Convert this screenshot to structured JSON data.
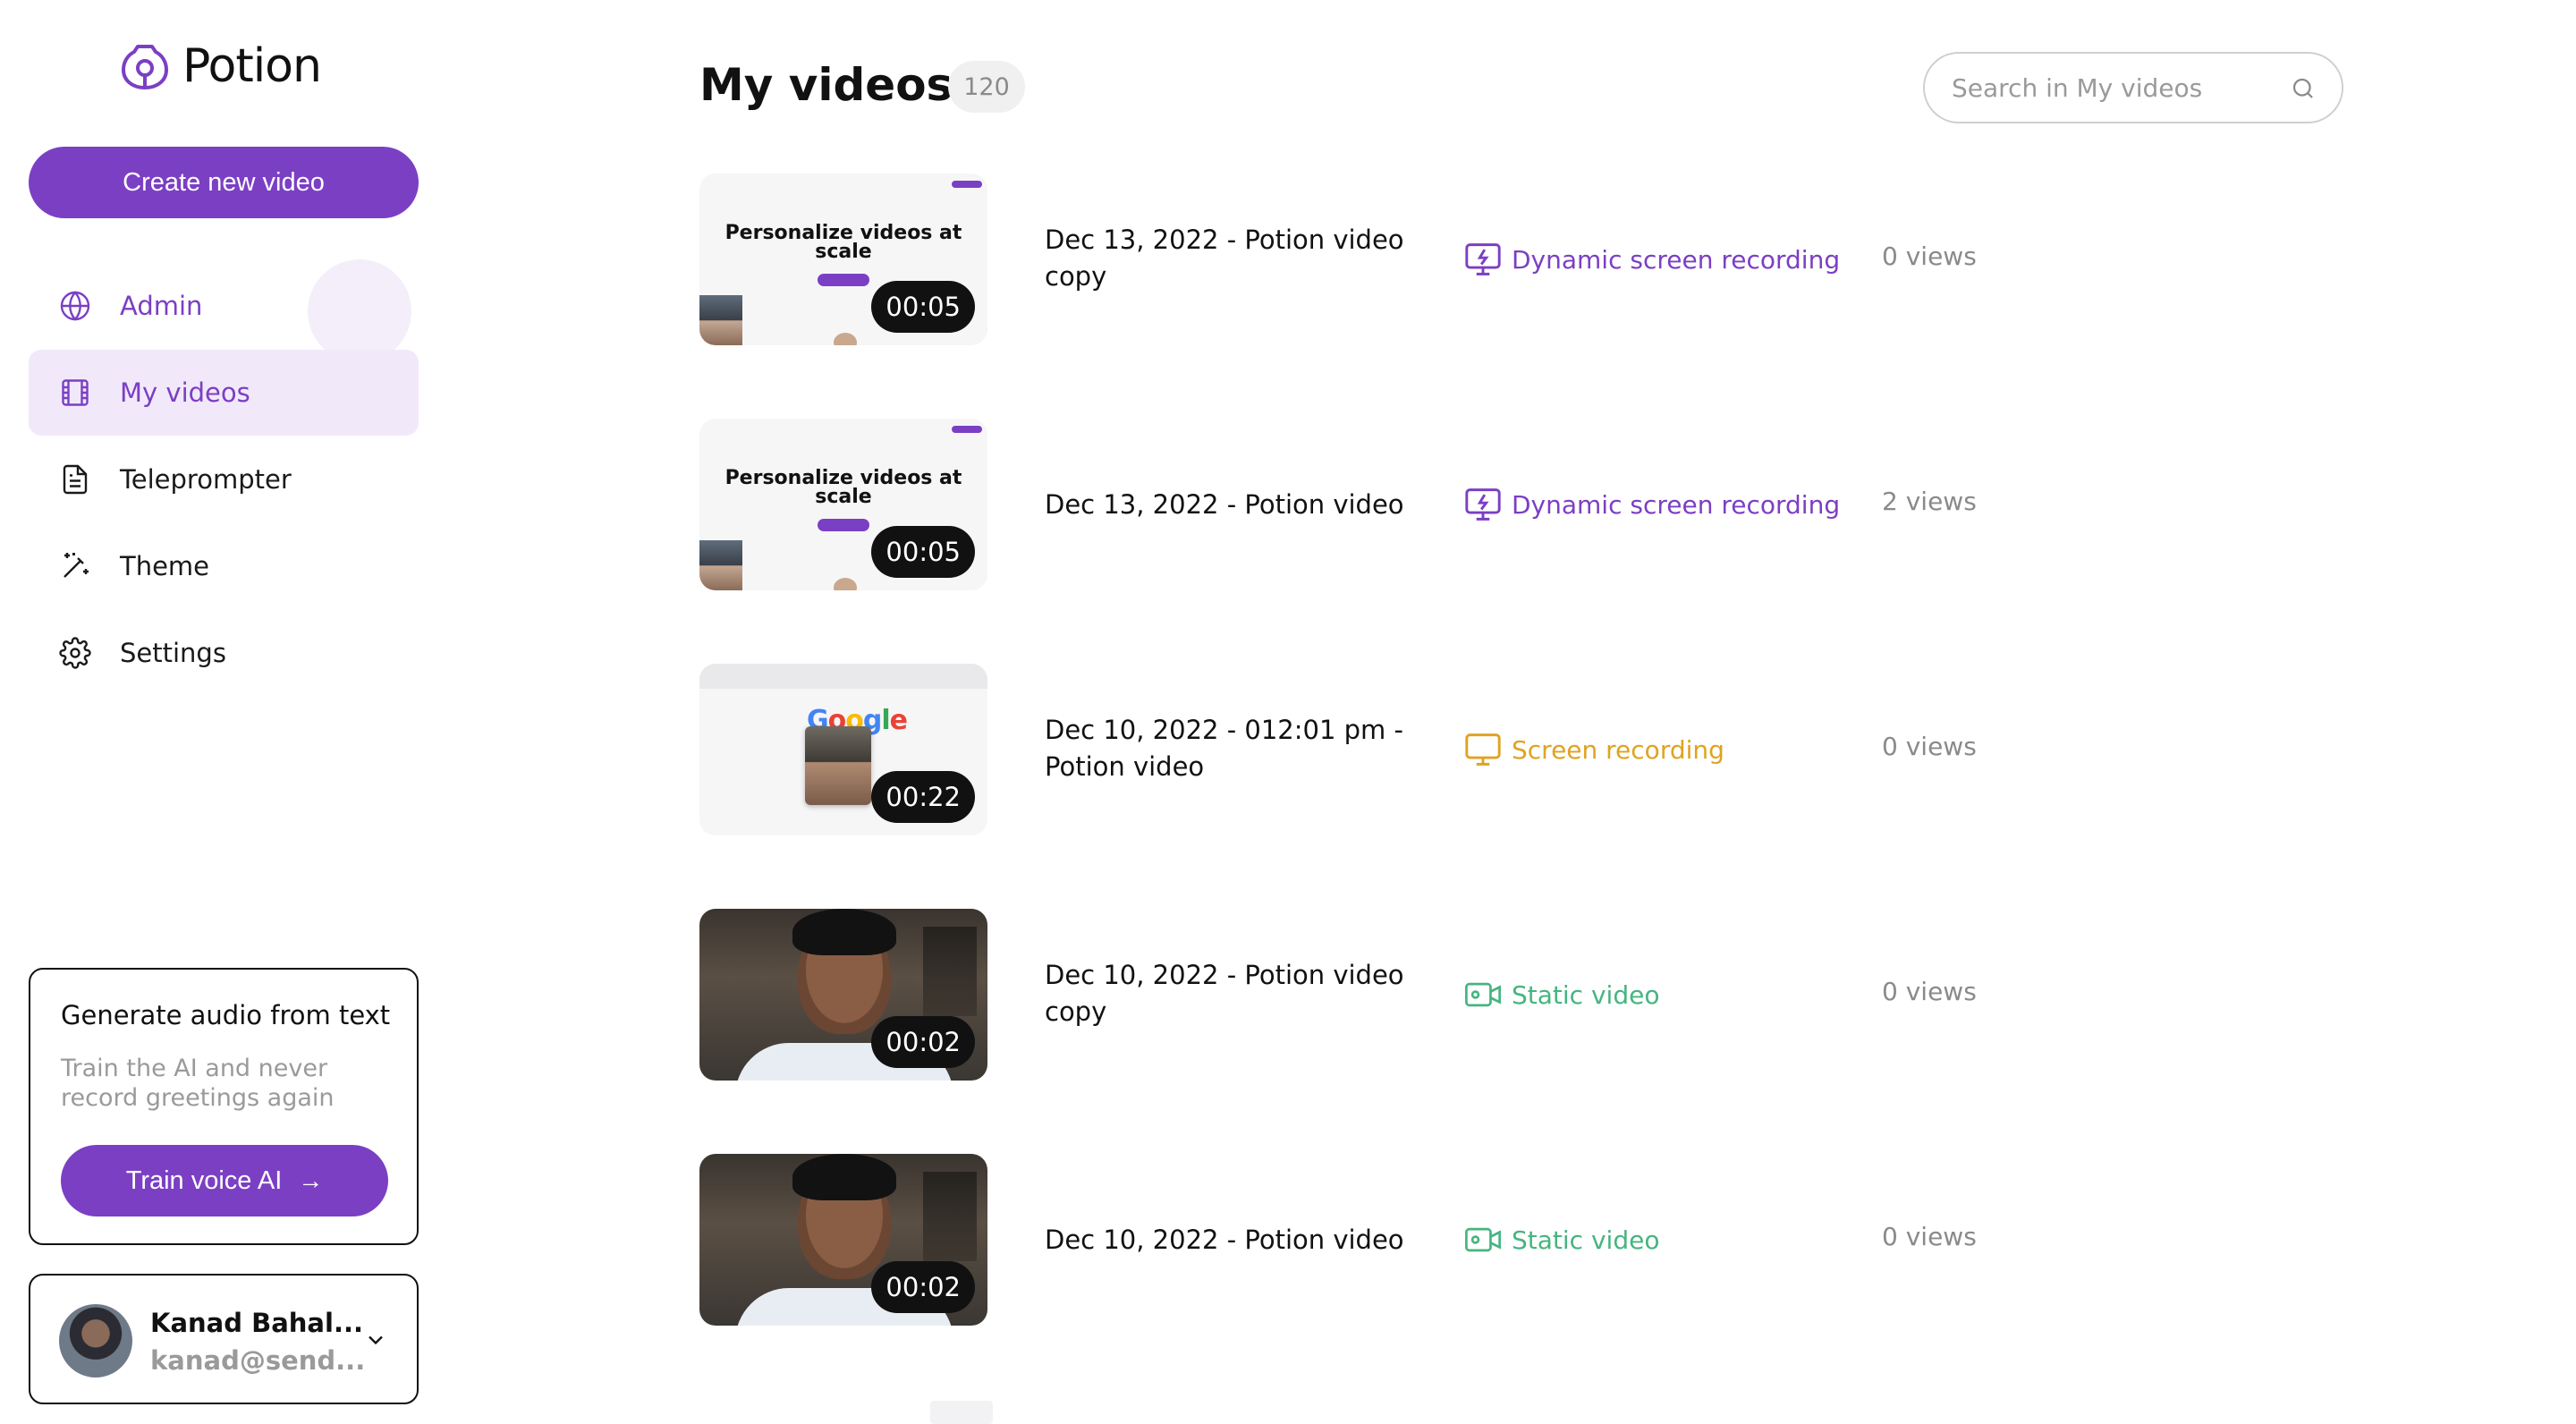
{
  "app": {
    "name": "Potion"
  },
  "sidebar": {
    "create_label": "Create new video",
    "items": [
      {
        "label": "Admin",
        "icon": "globe-icon"
      },
      {
        "label": "My videos",
        "icon": "film-icon"
      },
      {
        "label": "Teleprompter",
        "icon": "document-icon"
      },
      {
        "label": "Theme",
        "icon": "magic-wand-icon"
      },
      {
        "label": "Settings",
        "icon": "gear-icon"
      }
    ],
    "promo": {
      "title": "Generate audio from text",
      "subtitle": "Train the AI and never record greetings again",
      "button_label": "Train voice AI",
      "button_arrow": "→"
    },
    "user": {
      "name": "Kanad Bahal...",
      "email": "kanad@send..."
    }
  },
  "main": {
    "title": "My videos",
    "count": "120",
    "search": {
      "placeholder": "Search in My videos"
    },
    "videos": [
      {
        "title": "Dec 13, 2022 - Potion video copy",
        "duration": "00:05",
        "type": "Dynamic screen recording",
        "views": "0 views",
        "thumb_heading": "Personalize videos at scale"
      },
      {
        "title": "Dec 13, 2022 - Potion video",
        "duration": "00:05",
        "type": "Dynamic screen recording",
        "views": "2 views",
        "thumb_heading": "Personalize videos at scale"
      },
      {
        "title": "Dec 10, 2022 - 012:01 pm - Potion video",
        "duration": "00:22",
        "type": "Screen recording",
        "views": "0 views",
        "thumb_heading": "Google"
      },
      {
        "title": "Dec 10, 2022 - Potion video copy",
        "duration": "00:02",
        "type": "Static video",
        "views": "0 views"
      },
      {
        "title": "Dec 10, 2022 - Potion video",
        "duration": "00:02",
        "type": "Static video",
        "views": "0 views"
      }
    ]
  },
  "colors": {
    "accent": "#7b3fc4",
    "screen_recording": "#e0a321",
    "static_video": "#46b57f",
    "muted": "#8a8a8a"
  }
}
